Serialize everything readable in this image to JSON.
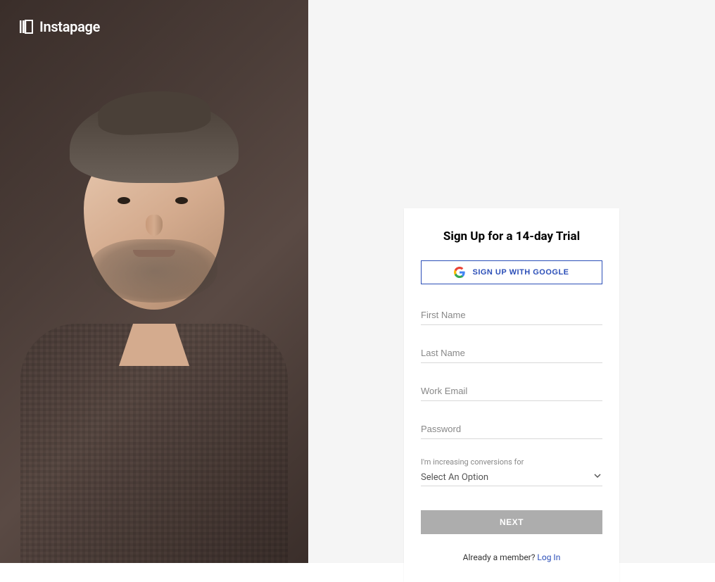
{
  "brand": {
    "name": "Instapage"
  },
  "signup": {
    "title": "Sign Up for a 14-day Trial",
    "google_button": "SIGN UP WITH GOOGLE",
    "fields": {
      "first_name_placeholder": "First Name",
      "last_name_placeholder": "Last Name",
      "email_placeholder": "Work Email",
      "password_placeholder": "Password"
    },
    "select": {
      "label": "I'm increasing conversions for",
      "value": "Select An Option"
    },
    "next_button": "NEXT",
    "footer": {
      "prompt": "Already a member? ",
      "link": "Log In"
    }
  }
}
